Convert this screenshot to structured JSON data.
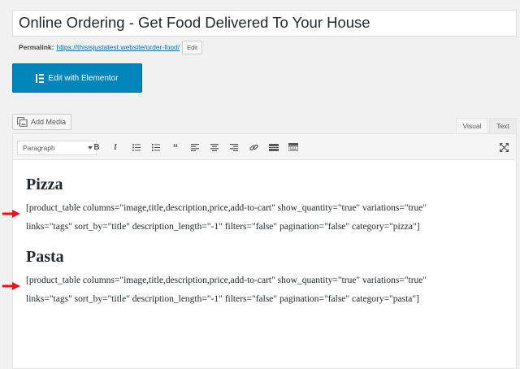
{
  "post_title": "Online Ordering - Get Food Delivered To Your House",
  "permalink": {
    "label": "Permalink:",
    "url": "https://thisisjustatest.website/order-food/",
    "edit_label": "Edit"
  },
  "elementor_button": {
    "label": "Edit with Elementor",
    "icon": "elementor-icon"
  },
  "add_media": {
    "label": "Add Media",
    "icon": "add-media-icon"
  },
  "tabs": {
    "visual": "Visual",
    "text": "Text"
  },
  "toolbar": {
    "format_value": "Paragraph",
    "buttons": [
      "bold-icon",
      "italic-icon",
      "bulleted-list-icon",
      "numbered-list-icon",
      "blockquote-icon",
      "align-left-icon",
      "align-center-icon",
      "align-right-icon",
      "insert-link-icon",
      "read-more-icon",
      "toolbar-toggle-icon"
    ],
    "fullscreen_icon": "fullscreen-icon"
  },
  "sections": [
    {
      "heading": "Pizza",
      "line1": "[product_table columns=\"image,title,description,price,add-to-cart\" show_quantity=\"true\" variations=\"true\"",
      "line2": "links=\"tags\" sort_by=\"title\" description_length=\"-1\" filters=\"false\" pagination=\"false\" category=\"pizza\"]"
    },
    {
      "heading": "Pasta",
      "line1": "[product_table columns=\"image,title,description,price,add-to-cart\" show_quantity=\"true\" variations=\"true\"",
      "line2": "links=\"tags\" sort_by=\"title\" description_length=\"-1\" filters=\"false\" pagination=\"false\" category=\"pasta\"]"
    }
  ],
  "colors": {
    "arrow": "#e8161b",
    "primary_button": "#0085ba",
    "link": "#0073aa"
  }
}
